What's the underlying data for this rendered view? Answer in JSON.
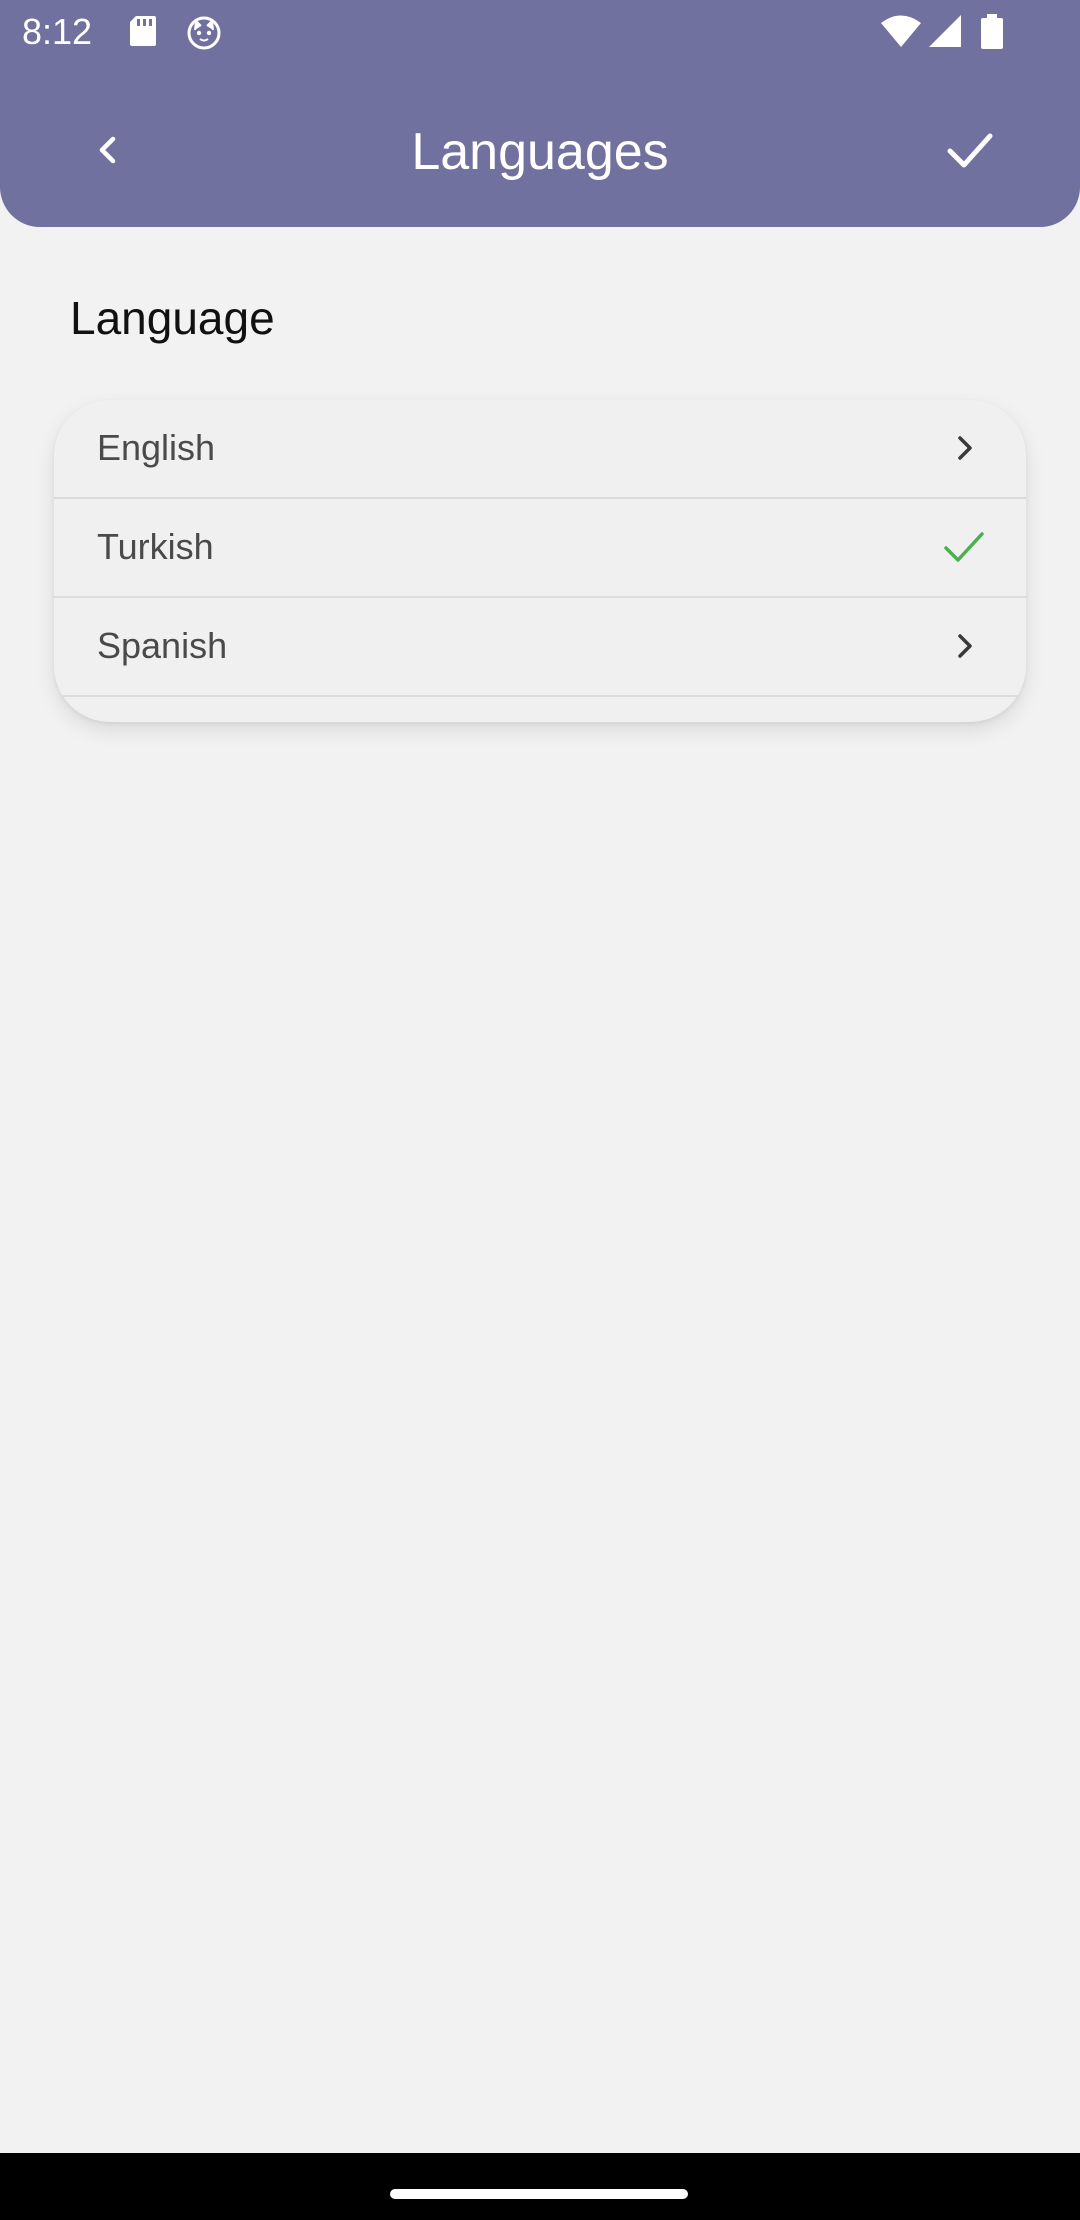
{
  "status_bar": {
    "time": "8:12",
    "icons_left": [
      "sd-card-icon",
      "cat-face-icon"
    ],
    "icons_right": [
      "wifi-icon",
      "signal-icon",
      "battery-icon"
    ]
  },
  "header": {
    "title": "Languages",
    "back_icon": "chevron-left-icon",
    "confirm_icon": "checkmark-icon",
    "background_color": "#70719e"
  },
  "section": {
    "title": "Language"
  },
  "languages": [
    {
      "label": "English",
      "selected": false,
      "trailing_icon": "chevron-right-icon"
    },
    {
      "label": "Turkish",
      "selected": true,
      "trailing_icon": "checkmark-icon"
    },
    {
      "label": "Spanish",
      "selected": false,
      "trailing_icon": "chevron-right-icon"
    }
  ],
  "colors": {
    "accent": "#70719e",
    "selected_check": "#4caf50",
    "background": "#f2f2f2"
  }
}
